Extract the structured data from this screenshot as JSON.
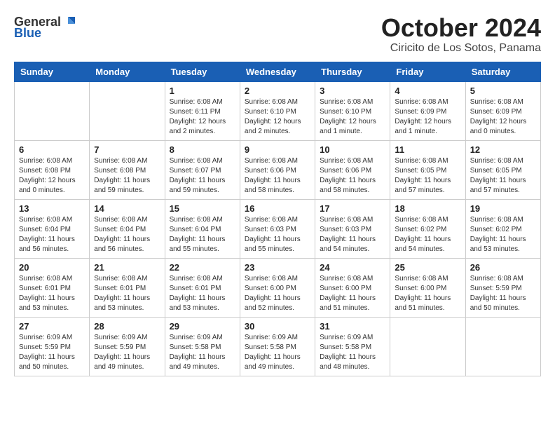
{
  "header": {
    "logo_general": "General",
    "logo_blue": "Blue",
    "month_title": "October 2024",
    "location": "Ciricito de Los Sotos, Panama"
  },
  "days_of_week": [
    "Sunday",
    "Monday",
    "Tuesday",
    "Wednesday",
    "Thursday",
    "Friday",
    "Saturday"
  ],
  "weeks": [
    [
      {
        "day": "",
        "info": ""
      },
      {
        "day": "",
        "info": ""
      },
      {
        "day": "1",
        "info": "Sunrise: 6:08 AM\nSunset: 6:11 PM\nDaylight: 12 hours and 2 minutes."
      },
      {
        "day": "2",
        "info": "Sunrise: 6:08 AM\nSunset: 6:10 PM\nDaylight: 12 hours and 2 minutes."
      },
      {
        "day": "3",
        "info": "Sunrise: 6:08 AM\nSunset: 6:10 PM\nDaylight: 12 hours and 1 minute."
      },
      {
        "day": "4",
        "info": "Sunrise: 6:08 AM\nSunset: 6:09 PM\nDaylight: 12 hours and 1 minute."
      },
      {
        "day": "5",
        "info": "Sunrise: 6:08 AM\nSunset: 6:09 PM\nDaylight: 12 hours and 0 minutes."
      }
    ],
    [
      {
        "day": "6",
        "info": "Sunrise: 6:08 AM\nSunset: 6:08 PM\nDaylight: 12 hours and 0 minutes."
      },
      {
        "day": "7",
        "info": "Sunrise: 6:08 AM\nSunset: 6:08 PM\nDaylight: 11 hours and 59 minutes."
      },
      {
        "day": "8",
        "info": "Sunrise: 6:08 AM\nSunset: 6:07 PM\nDaylight: 11 hours and 59 minutes."
      },
      {
        "day": "9",
        "info": "Sunrise: 6:08 AM\nSunset: 6:06 PM\nDaylight: 11 hours and 58 minutes."
      },
      {
        "day": "10",
        "info": "Sunrise: 6:08 AM\nSunset: 6:06 PM\nDaylight: 11 hours and 58 minutes."
      },
      {
        "day": "11",
        "info": "Sunrise: 6:08 AM\nSunset: 6:05 PM\nDaylight: 11 hours and 57 minutes."
      },
      {
        "day": "12",
        "info": "Sunrise: 6:08 AM\nSunset: 6:05 PM\nDaylight: 11 hours and 57 minutes."
      }
    ],
    [
      {
        "day": "13",
        "info": "Sunrise: 6:08 AM\nSunset: 6:04 PM\nDaylight: 11 hours and 56 minutes."
      },
      {
        "day": "14",
        "info": "Sunrise: 6:08 AM\nSunset: 6:04 PM\nDaylight: 11 hours and 56 minutes."
      },
      {
        "day": "15",
        "info": "Sunrise: 6:08 AM\nSunset: 6:04 PM\nDaylight: 11 hours and 55 minutes."
      },
      {
        "day": "16",
        "info": "Sunrise: 6:08 AM\nSunset: 6:03 PM\nDaylight: 11 hours and 55 minutes."
      },
      {
        "day": "17",
        "info": "Sunrise: 6:08 AM\nSunset: 6:03 PM\nDaylight: 11 hours and 54 minutes."
      },
      {
        "day": "18",
        "info": "Sunrise: 6:08 AM\nSunset: 6:02 PM\nDaylight: 11 hours and 54 minutes."
      },
      {
        "day": "19",
        "info": "Sunrise: 6:08 AM\nSunset: 6:02 PM\nDaylight: 11 hours and 53 minutes."
      }
    ],
    [
      {
        "day": "20",
        "info": "Sunrise: 6:08 AM\nSunset: 6:01 PM\nDaylight: 11 hours and 53 minutes."
      },
      {
        "day": "21",
        "info": "Sunrise: 6:08 AM\nSunset: 6:01 PM\nDaylight: 11 hours and 53 minutes."
      },
      {
        "day": "22",
        "info": "Sunrise: 6:08 AM\nSunset: 6:01 PM\nDaylight: 11 hours and 53 minutes."
      },
      {
        "day": "23",
        "info": "Sunrise: 6:08 AM\nSunset: 6:00 PM\nDaylight: 11 hours and 52 minutes."
      },
      {
        "day": "24",
        "info": "Sunrise: 6:08 AM\nSunset: 6:00 PM\nDaylight: 11 hours and 51 minutes."
      },
      {
        "day": "25",
        "info": "Sunrise: 6:08 AM\nSunset: 6:00 PM\nDaylight: 11 hours and 51 minutes."
      },
      {
        "day": "26",
        "info": "Sunrise: 6:08 AM\nSunset: 5:59 PM\nDaylight: 11 hours and 50 minutes."
      }
    ],
    [
      {
        "day": "27",
        "info": "Sunrise: 6:09 AM\nSunset: 5:59 PM\nDaylight: 11 hours and 50 minutes."
      },
      {
        "day": "28",
        "info": "Sunrise: 6:09 AM\nSunset: 5:59 PM\nDaylight: 11 hours and 49 minutes."
      },
      {
        "day": "29",
        "info": "Sunrise: 6:09 AM\nSunset: 5:58 PM\nDaylight: 11 hours and 49 minutes."
      },
      {
        "day": "30",
        "info": "Sunrise: 6:09 AM\nSunset: 5:58 PM\nDaylight: 11 hours and 49 minutes."
      },
      {
        "day": "31",
        "info": "Sunrise: 6:09 AM\nSunset: 5:58 PM\nDaylight: 11 hours and 48 minutes."
      },
      {
        "day": "",
        "info": ""
      },
      {
        "day": "",
        "info": ""
      }
    ]
  ]
}
